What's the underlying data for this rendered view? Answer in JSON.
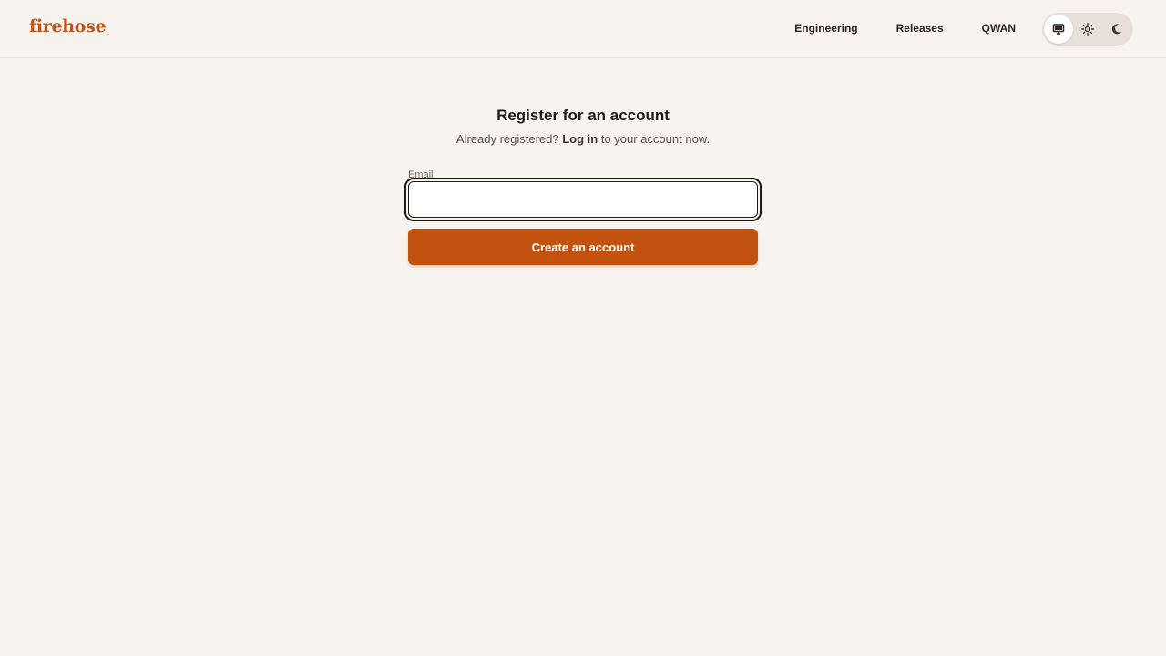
{
  "brand": {
    "logo_text": "firehose"
  },
  "nav": {
    "items": [
      {
        "label": "Engineering"
      },
      {
        "label": "Releases"
      },
      {
        "label": "QWAN"
      }
    ]
  },
  "theme_switch": {
    "options": [
      {
        "name": "system",
        "icon": "monitor-icon",
        "active": true
      },
      {
        "name": "light",
        "icon": "sun-icon",
        "active": false
      },
      {
        "name": "dark",
        "icon": "moon-icon",
        "active": false
      }
    ]
  },
  "register": {
    "title": "Register for an account",
    "subtitle_prefix": "Already registered? ",
    "login_link": "Log in",
    "subtitle_suffix": " to your account now.",
    "email_label": "Email",
    "email_value": "",
    "email_placeholder": "",
    "submit_label": "Create an account"
  },
  "colors": {
    "background": "#f7f4ef",
    "accent": "#c4520f",
    "logo": "#c2531a"
  }
}
